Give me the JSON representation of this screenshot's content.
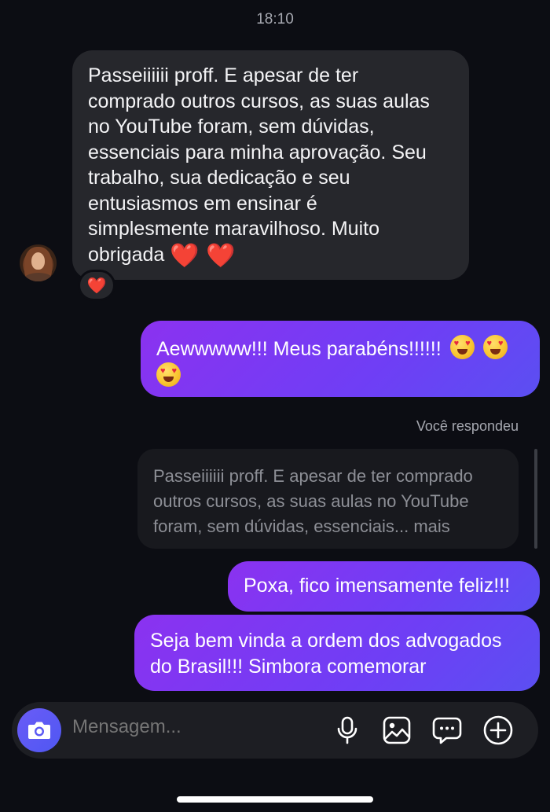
{
  "header": {
    "time": "18:10"
  },
  "incoming_message": {
    "text_line1": "Passeiiiiii proff. E apesar de ter",
    "text_line2": "comprado outros cursos, as suas aulas",
    "text_line3": "no YouTube foram, sem dúvidas,",
    "text_line4": "essenciais para minha aprovação. Seu",
    "text_line5": "trabalho, sua dedicação e seu",
    "text_line6": "entusiasmos em ensinar é",
    "text_line7": "simplesmente maravilhoso. Muito",
    "text_line8": "obrigada",
    "hearts": "❤️ ❤️",
    "reaction": "❤️"
  },
  "outgoing_messages": {
    "msg1_text": "Aewwwww!!! Meus parabéns!!!!!!",
    "msg2_text": "Poxa, fico imensamente feliz!!!",
    "msg3_line1": "Seja bem vinda a ordem dos advogados",
    "msg3_line2": "do Brasil!!! Simbora comemorar"
  },
  "reply": {
    "label": "Você respondeu",
    "preview_line1": "Passeiiiiii proff. E apesar de ter comprado",
    "preview_line2": "outros cursos, as suas aulas no YouTube",
    "preview_line3": "foram, sem dúvidas, essenciais... mais"
  },
  "composer": {
    "placeholder": "Mensagem...",
    "icons": [
      "camera-icon",
      "microphone-icon",
      "gallery-icon",
      "chat-bubble-icon",
      "add-circle-icon"
    ]
  },
  "colors": {
    "background": "#0c0d13",
    "incoming_bubble": "#26272c",
    "outgoing_gradient_start": "#8b32f0",
    "outgoing_gradient_end": "#5b4ff2",
    "accent_camera": "#5a58f4"
  }
}
